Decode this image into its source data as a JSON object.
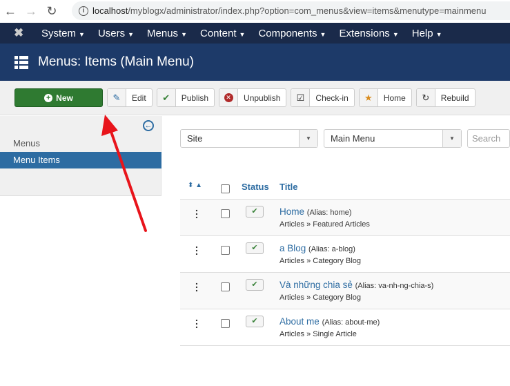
{
  "browser": {
    "url_host": "localhost",
    "url_rest": "/myblogx/administrator/index.php?option=com_menus&view=items&menutype=mainmenu"
  },
  "topnav": {
    "items": [
      "System",
      "Users",
      "Menus",
      "Content",
      "Components",
      "Extensions",
      "Help"
    ]
  },
  "header": {
    "title": "Menus: Items (Main Menu)"
  },
  "toolbar": {
    "new": "New",
    "edit": "Edit",
    "publish": "Publish",
    "unpublish": "Unpublish",
    "checkin": "Check-in",
    "home": "Home",
    "rebuild": "Rebuild"
  },
  "sidebar": {
    "items": [
      {
        "label": "Menus"
      },
      {
        "label": "Menu Items",
        "active": true
      }
    ]
  },
  "filters": {
    "client": "Site",
    "menu": "Main Menu",
    "search_placeholder": "Search"
  },
  "table": {
    "headers": {
      "status": "Status",
      "title": "Title"
    },
    "rows": [
      {
        "title": "Home",
        "alias": "(Alias: home)",
        "type": "Articles » Featured Articles",
        "published": true
      },
      {
        "title": "a Blog",
        "alias": "(Alias: a-blog)",
        "type": "Articles » Category Blog",
        "published": true
      },
      {
        "title": "Và những chia sẻ",
        "alias": "(Alias: va-nh-ng-chia-s)",
        "type": "Articles » Category Blog",
        "published": true
      },
      {
        "title": "About me",
        "alias": "(Alias: about-me)",
        "type": "Articles » Single Article",
        "published": true
      }
    ]
  },
  "annotation": {
    "arrow_color": "#e8141b"
  },
  "colors": {
    "nav": "#1a2a4a",
    "header": "#1d3a69",
    "new_button": "#2f7a31",
    "accent": "#2d6ca2"
  }
}
